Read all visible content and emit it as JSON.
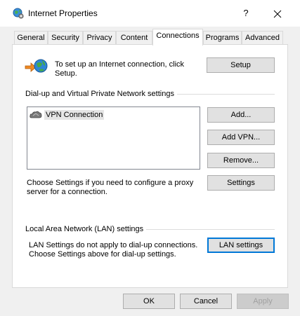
{
  "window": {
    "title": "Internet Properties",
    "help_glyph": "?",
    "icon": "globe-gear-icon"
  },
  "tabs": [
    {
      "label": "General",
      "active": false
    },
    {
      "label": "Security",
      "active": false
    },
    {
      "label": "Privacy",
      "active": false
    },
    {
      "label": "Content",
      "active": false
    },
    {
      "label": "Connections",
      "active": true
    },
    {
      "label": "Programs",
      "active": false
    },
    {
      "label": "Advanced",
      "active": false
    }
  ],
  "connections": {
    "setup_text_line1": "To set up an Internet connection, click",
    "setup_text_line2": "Setup.",
    "setup_button": "Setup",
    "dialup_group_label": "Dial-up and Virtual Private Network settings",
    "connections_list": [
      {
        "label": "VPN Connection",
        "icon": "vpn-connection-icon",
        "selected": true
      }
    ],
    "add_button": "Add...",
    "add_vpn_button": "Add VPN...",
    "remove_button": "Remove...",
    "settings_text_line1": "Choose Settings if you need to configure a proxy",
    "settings_text_line2": "server for a connection.",
    "settings_button": "Settings",
    "lan_group_label": "Local Area Network (LAN) settings",
    "lan_text_line1": "LAN Settings do not apply to dial-up connections.",
    "lan_text_line2": "Choose Settings above for dial-up settings.",
    "lan_settings_button": "LAN settings"
  },
  "footer": {
    "ok_button": "OK",
    "cancel_button": "Cancel",
    "apply_button": "Apply"
  },
  "colors": {
    "focus_border": "#0078d7",
    "window_bg": "#f0f0f0",
    "panel_bg": "#ffffff"
  }
}
